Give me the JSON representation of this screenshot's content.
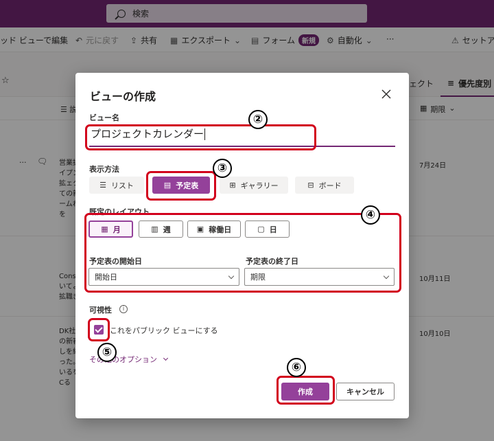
{
  "search": {
    "placeholder": "検索"
  },
  "commandbar": {
    "grid_edit": "ッド ビューで編集",
    "undo": "元に戻す",
    "share": "共有",
    "export": "エクスポート",
    "form": "フォーム",
    "form_badge": "新規",
    "automate": "自動化",
    "more": "···",
    "setup": "セットア"
  },
  "viewbar": {
    "tab_project": "ェクト",
    "tab_priority": "優先度別"
  },
  "columns": {
    "deadline": "期限"
  },
  "rows": [
    {
      "text": "営業拡ザイプング拡ェクトての新チームわせを",
      "date": "7月24日"
    },
    {
      "text": "Constついてよる拡職ぎ",
      "date": "10月11日"
    },
    {
      "text": "DK社との新審でしを終了った。ているを、Cる",
      "date": "10月10日"
    }
  ],
  "dialog": {
    "title": "ビューの作成",
    "name_label": "ビュー名",
    "name_value": "プロジェクトカレンダー",
    "display_label": "表示方法",
    "display_options": [
      "リスト",
      "予定表",
      "ギャラリー",
      "ボード"
    ],
    "display_selected": "予定表",
    "layout_label": "既定のレイアウト",
    "layout_options": [
      "月",
      "週",
      "稼働日",
      "日"
    ],
    "layout_selected": "月",
    "start_label": "予定表の開始日",
    "start_value": "開始日",
    "end_label": "予定表の終了日",
    "end_value": "期限",
    "visibility_label": "可視性",
    "public_checkbox_label": "これをパブリック ビューにする",
    "public_checked": true,
    "more_options": "その他のオプション",
    "create_button": "作成",
    "cancel_button": "キャンセル"
  },
  "annotations": [
    "②",
    "③",
    "④",
    "⑤",
    "⑥"
  ],
  "colors": {
    "accent": "#94419a",
    "topbar": "#742774",
    "annotation": "#d2001c"
  }
}
